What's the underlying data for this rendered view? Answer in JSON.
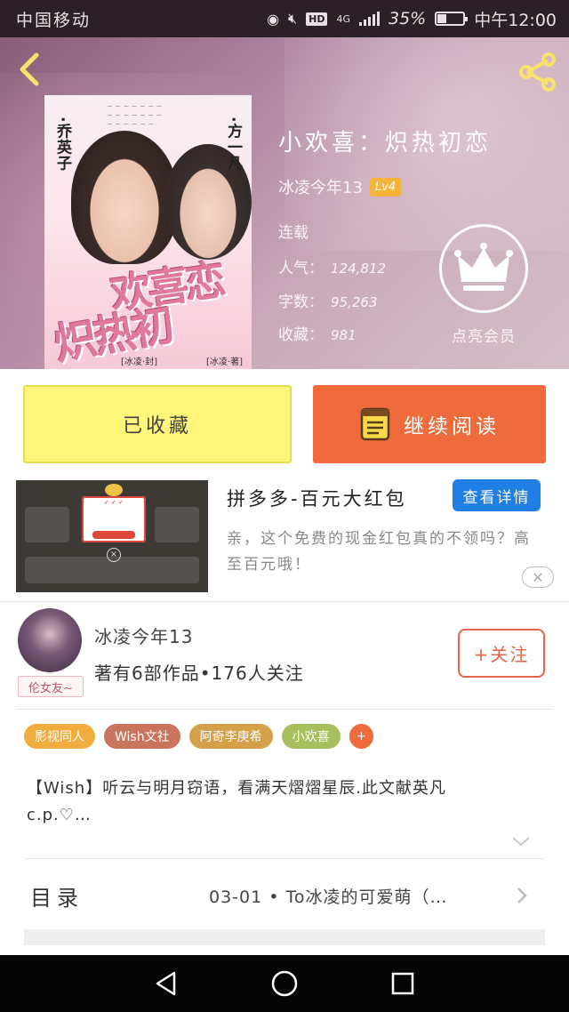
{
  "status_bar": {
    "carrier": "中国移动",
    "network_badge": "HD",
    "network_type": "4G",
    "battery_percent": "35%",
    "battery_level": 0.35,
    "time": "中午12:00"
  },
  "header": {
    "book_title": "小欢喜：炽热初恋",
    "author": "冰凌今年13",
    "level_badge": "Lv4",
    "status": "连载",
    "popularity_label": "人气：",
    "popularity_value": "124,812",
    "word_count_label": "字数：",
    "word_count_value": "95,263",
    "favorites_label": "收藏：",
    "favorites_value": "981",
    "vip_label": "点亮会员",
    "cover": {
      "title_line1": "欢喜恋",
      "title_line2": "炽热初",
      "name_left": "·乔英子",
      "name_right": "·方一凡",
      "credit_left": "[冰凌·封]",
      "credit_right": "[冰凌·著]"
    }
  },
  "actions": {
    "favorited_label": "已收藏",
    "continue_reading_label": "继续阅读"
  },
  "ad": {
    "title": "拼多多-百元大红包",
    "detail_button": "查看详情",
    "description": "亲，这个免费的现金红包真的不领吗？高至百元哦！",
    "close_label": "✕"
  },
  "author_card": {
    "name": "冰凌今年13",
    "stats": "著有6部作品•176人关注",
    "avatar_tag": "伦女友~",
    "follow_label": "+关注"
  },
  "tags": [
    {
      "label": "影视同人",
      "color": "#f0ad3d"
    },
    {
      "label": "Wish文社",
      "color": "#c9755e"
    },
    {
      "label": "阿奇李庚希",
      "color": "#d5a04a"
    },
    {
      "label": "小欢喜",
      "color": "#a6c060"
    },
    {
      "label": "+",
      "color": "#ef6b3b"
    }
  ],
  "synopsis": "【Wish】听云与明月窃语，看满天熠熠星辰.此文献英凡c.p.♡…",
  "toc": {
    "title": "目录",
    "latest_chapter": "03-01 • To冰凌的可爱萌（…"
  },
  "colors": {
    "favorite_button": "#fff67a",
    "read_button": "#ef6b3b",
    "detail_button": "#1f7fe5",
    "follow_border": "#e3664a"
  }
}
